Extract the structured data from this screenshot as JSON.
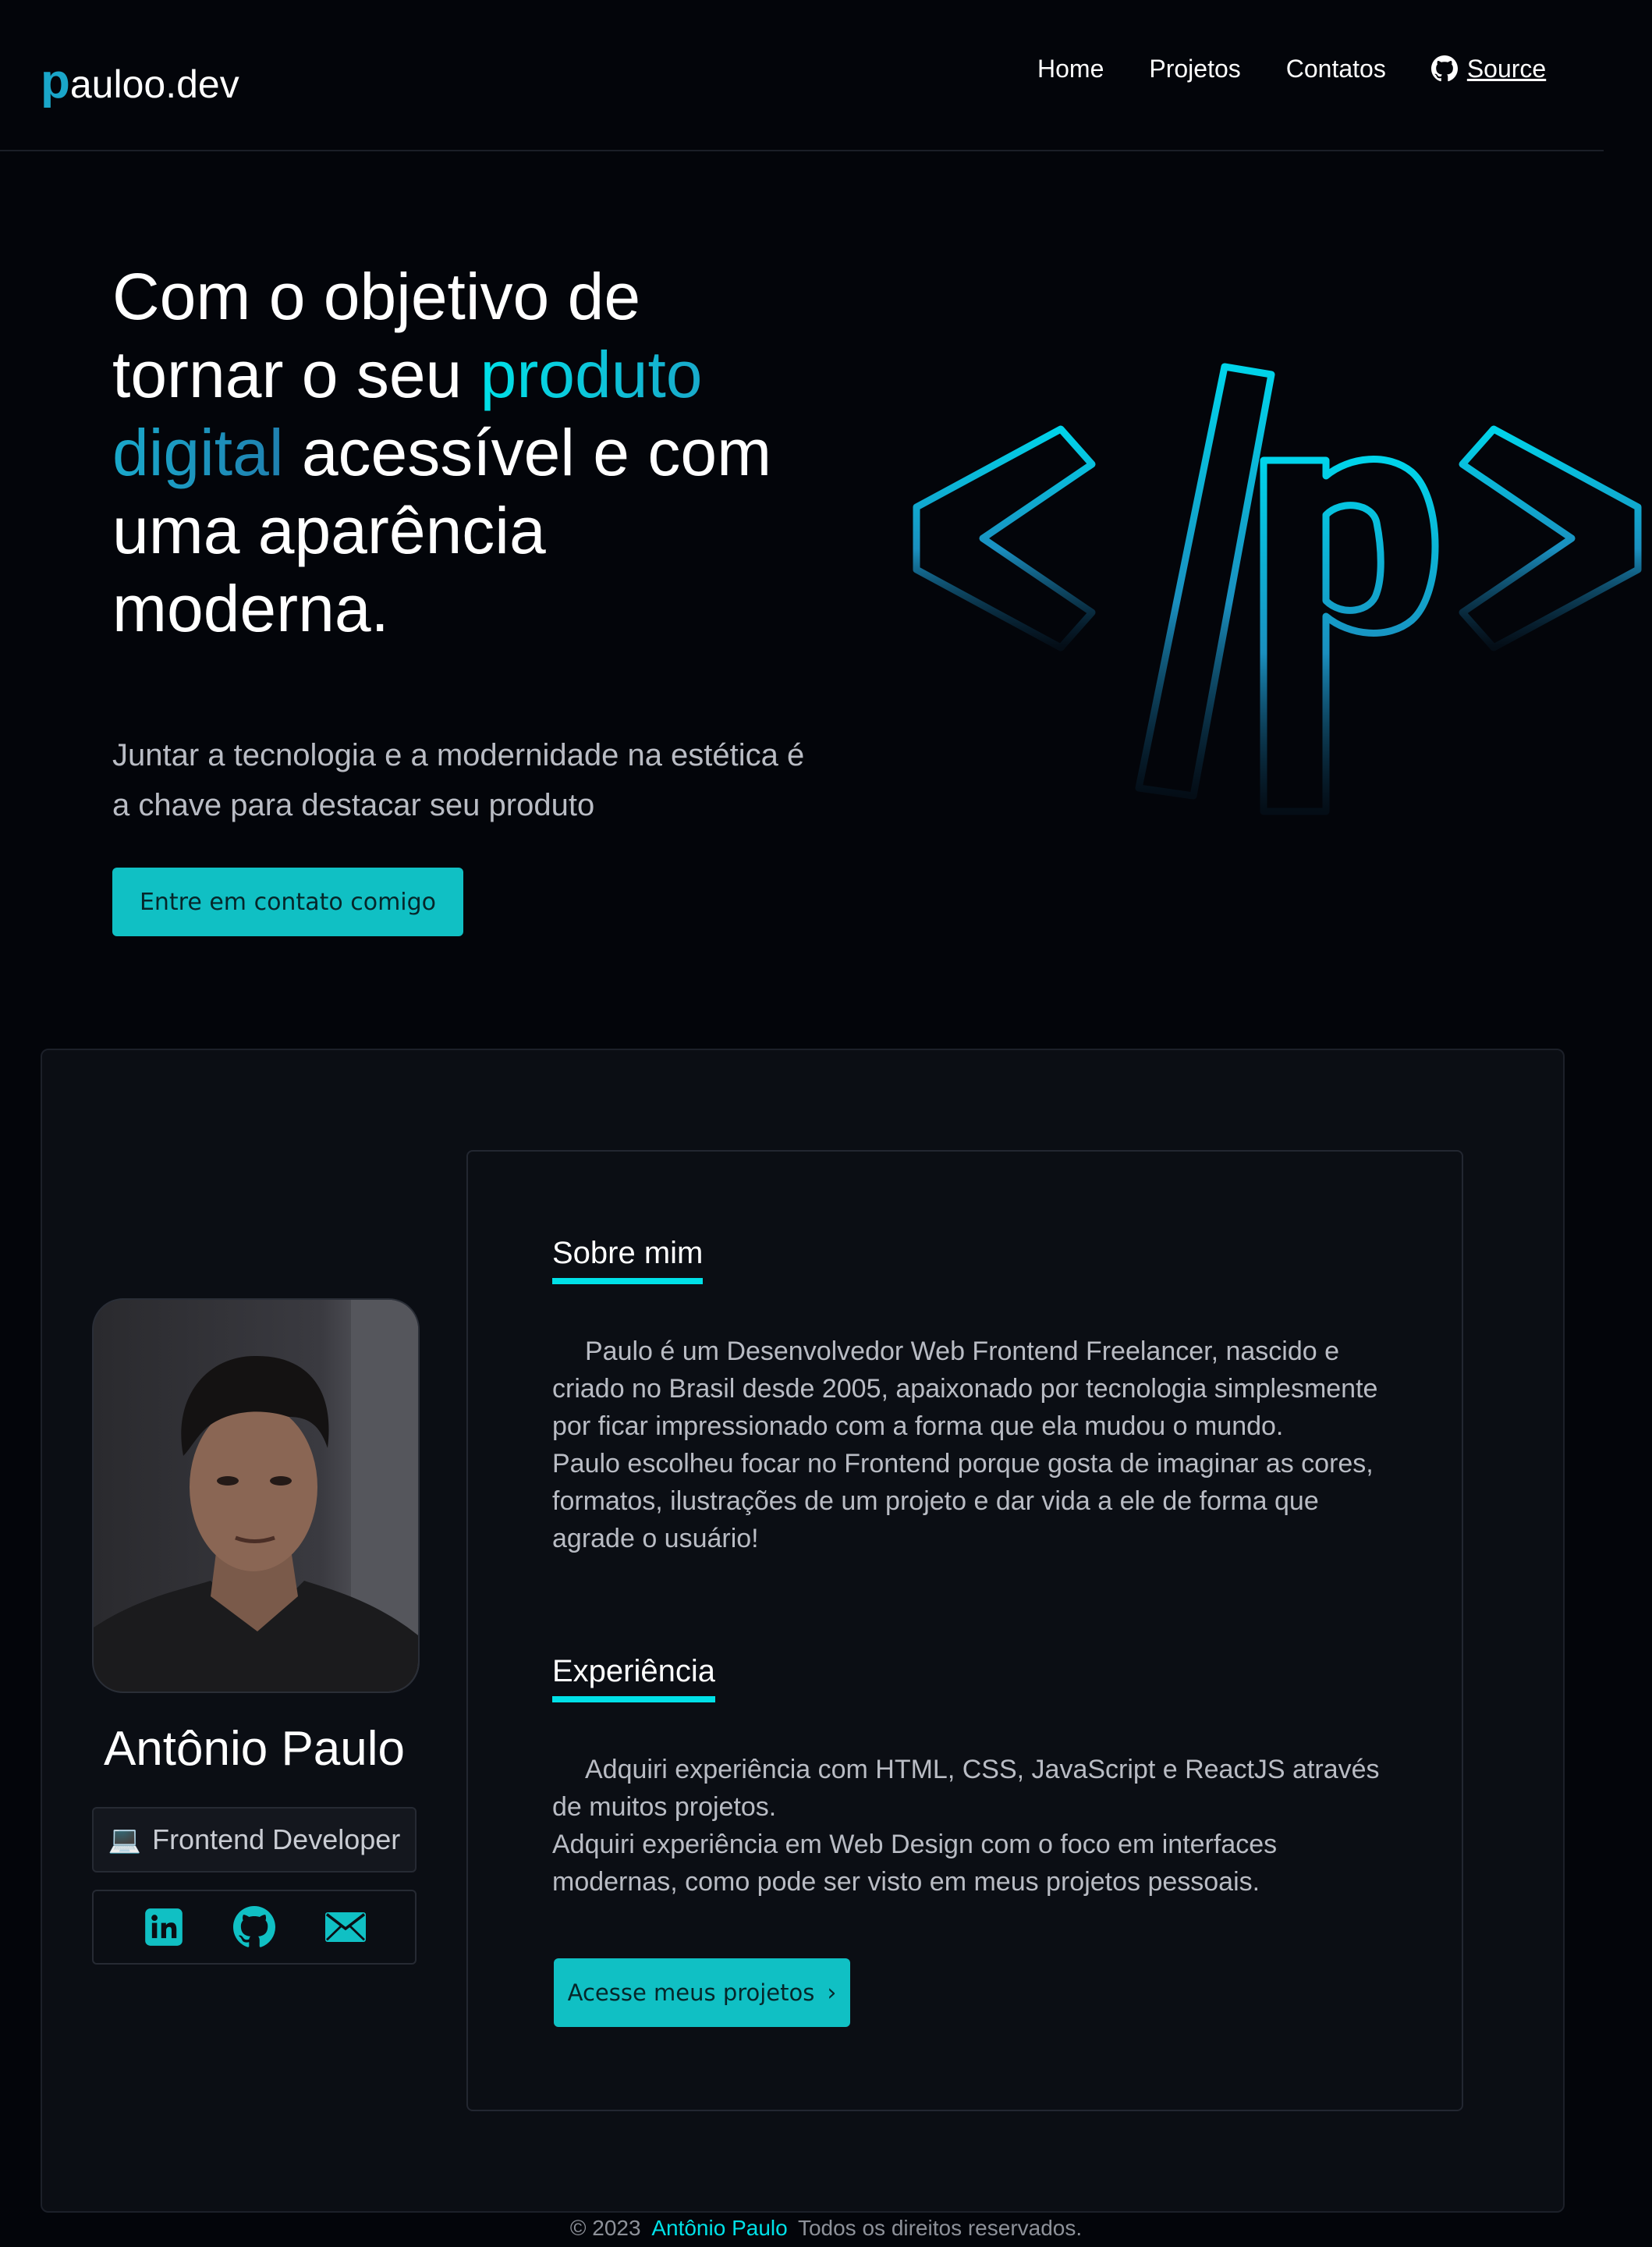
{
  "navbar": {
    "logo_letter": "p",
    "logo_rest": "auloo.dev",
    "links": [
      {
        "label": "Home"
      },
      {
        "label": "Projetos"
      },
      {
        "label": "Contatos"
      }
    ],
    "source_label": "Source"
  },
  "hero": {
    "title_part1": "Com o objetivo de tornar o seu ",
    "title_accent": "produto digital",
    "title_part2": " acessível e com uma aparência moderna.",
    "subtitle": "Juntar a tecnologia e a modernidade na estética é a chave para destacar seu produto",
    "cta_label": "Entre em contato comigo",
    "art_icon": "code-logo"
  },
  "profile": {
    "name": "Antônio Paulo",
    "role_icon": "💻",
    "role": "Frontend Developer",
    "socials": [
      {
        "icon": "linkedin-icon"
      },
      {
        "icon": "github-icon"
      },
      {
        "icon": "mail-icon"
      }
    ]
  },
  "about": {
    "heading": "Sobre mim",
    "paragraph1": "Paulo é um Desenvolvedor Web Frontend Freelancer, nascido e criado no Brasil desde 2005, apaixonado por tecnologia simplesmente por ficar impressionado com a forma que ela mudou o mundo.",
    "paragraph2": "Paulo escolheu focar no Frontend porque gosta de imaginar as cores, formatos, ilustrações de um projeto e dar vida a ele de forma que agrade o usuário!"
  },
  "experience": {
    "heading": "Experiência",
    "paragraph1": "Adquiri experiência com HTML, CSS, JavaScript e ReactJS através de muitos projetos.",
    "paragraph2": "Adquiri experiência em Web Design com o foco em interfaces modernas, como pode ser visto em meus projetos pessoais.",
    "cta_label": "Acesse meus projetos",
    "cta_icon": "›"
  },
  "footer": {
    "prefix": "© 2023",
    "author": "Antônio Paulo",
    "suffix": "Todos os direitos reservados."
  },
  "colors": {
    "background": "#03050a",
    "accent": "#00e1e8",
    "accent_dark": "#1aa6c9",
    "button": "#10c0c4",
    "card": "#0b0e14"
  }
}
